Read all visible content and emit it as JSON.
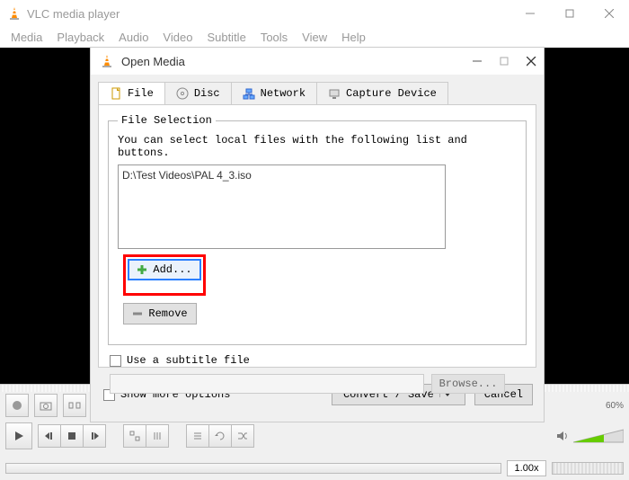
{
  "titlebar": {
    "title": "VLC media player"
  },
  "menubar": [
    "Media",
    "Playback",
    "Audio",
    "Video",
    "Subtitle",
    "Tools",
    "View",
    "Help"
  ],
  "dialog": {
    "title": "Open Media",
    "tabs": [
      {
        "label": "File"
      },
      {
        "label": "Disc"
      },
      {
        "label": "Network"
      },
      {
        "label": "Capture Device"
      }
    ],
    "file_selection": {
      "legend": "File Selection",
      "instruction": "You can select local files with the following list and buttons.",
      "files": [
        "D:\\Test Videos\\PAL 4_3.iso"
      ],
      "add_label": "Add...",
      "remove_label": "Remove"
    },
    "subtitle": {
      "checkbox_label": "Use a subtitle file",
      "browse_label": "Browse..."
    },
    "show_more_label": "Show more options",
    "convert_label": "Convert / Save",
    "cancel_label": "Cancel"
  },
  "controls": {
    "speed": "1.00x",
    "volume_pct": "60%"
  }
}
